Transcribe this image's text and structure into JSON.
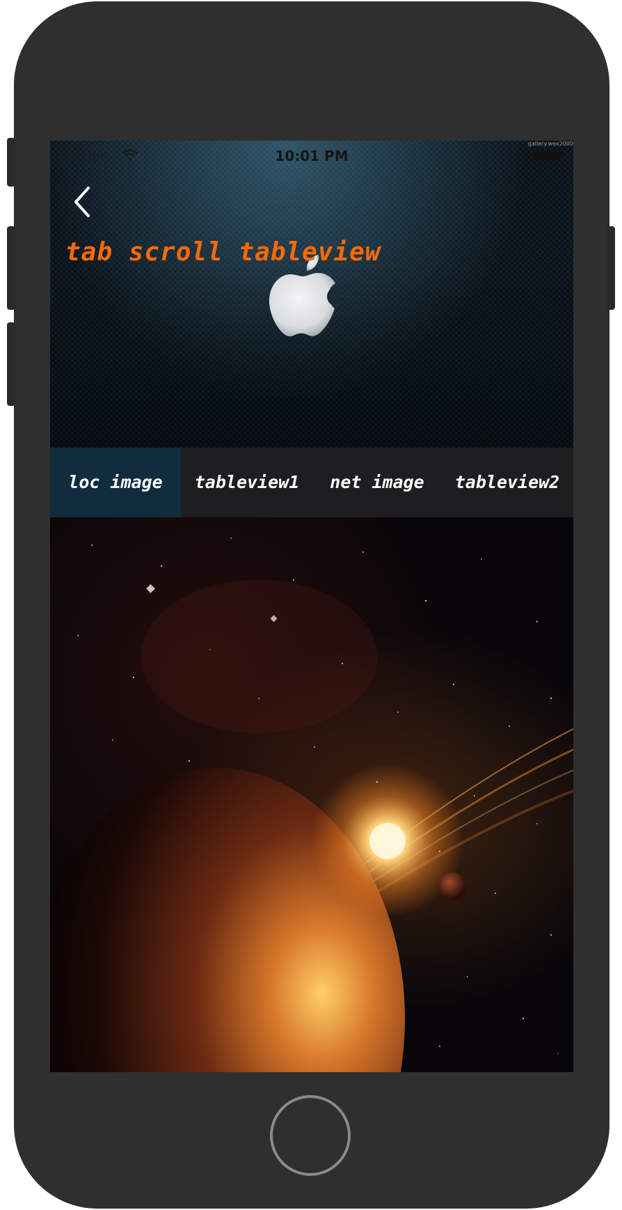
{
  "status_bar": {
    "carrier": "Carrier",
    "time": "10:01 PM",
    "watermark": "gallery.wex2000"
  },
  "navbar": {
    "back_icon": "chevron-left-icon",
    "title": "tab scroll tableview"
  },
  "tabs": [
    {
      "label": "loc image",
      "active": true
    },
    {
      "label": "tableview1",
      "active": false
    },
    {
      "label": "net image",
      "active": false
    },
    {
      "label": "tableview2",
      "active": false
    }
  ],
  "colors": {
    "title": "#ff6a00",
    "active_tab": "#112d3d",
    "tabbar": "#1e1d1f",
    "phone_body": "#2f2f2f"
  },
  "content": {
    "image": "planet-space-image"
  }
}
